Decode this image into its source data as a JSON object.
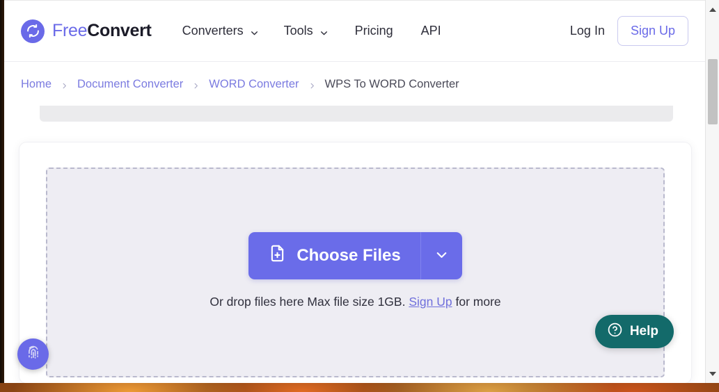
{
  "brand": {
    "name_light": "Free",
    "name_bold": "Convert",
    "logo_icon": "sync-circle-icon",
    "accent_color": "#6a6ae8"
  },
  "navbar": {
    "items": [
      {
        "label": "Converters",
        "has_dropdown": true
      },
      {
        "label": "Tools",
        "has_dropdown": true
      },
      {
        "label": "Pricing",
        "has_dropdown": false
      },
      {
        "label": "API",
        "has_dropdown": false
      }
    ],
    "login_label": "Log In",
    "signup_label": "Sign Up"
  },
  "breadcrumb": {
    "items": [
      {
        "label": "Home",
        "current": false
      },
      {
        "label": "Document Converter",
        "current": false
      },
      {
        "label": "WORD Converter",
        "current": false
      },
      {
        "label": "WPS To WORD Converter",
        "current": true
      }
    ],
    "separator_icon": "chevron-right-icon",
    "link_color": "#7b7be0",
    "current_color": "#4a4a58"
  },
  "uploader": {
    "choose_files_label": "Choose Files",
    "choose_files_icon": "file-plus-icon",
    "dropdown_icon": "chevron-down-icon",
    "drop_text_before": "Or drop files here Max file size 1GB.",
    "drop_link_label": "Sign Up",
    "drop_text_after": "for more",
    "button_color": "#6a6ce9",
    "dropzone_fill": "#eeedf3",
    "dropzone_border": "#b9b9cd"
  },
  "help_widget": {
    "label": "Help",
    "icon": "question-circle-icon",
    "background_color": "#136a6a"
  },
  "privacy_widget": {
    "icon": "fingerprint-icon",
    "background_color": "#6a6ae8"
  },
  "scrollbar": {
    "up_icon": "triangle-up-icon",
    "down_icon": "triangle-down-icon"
  }
}
